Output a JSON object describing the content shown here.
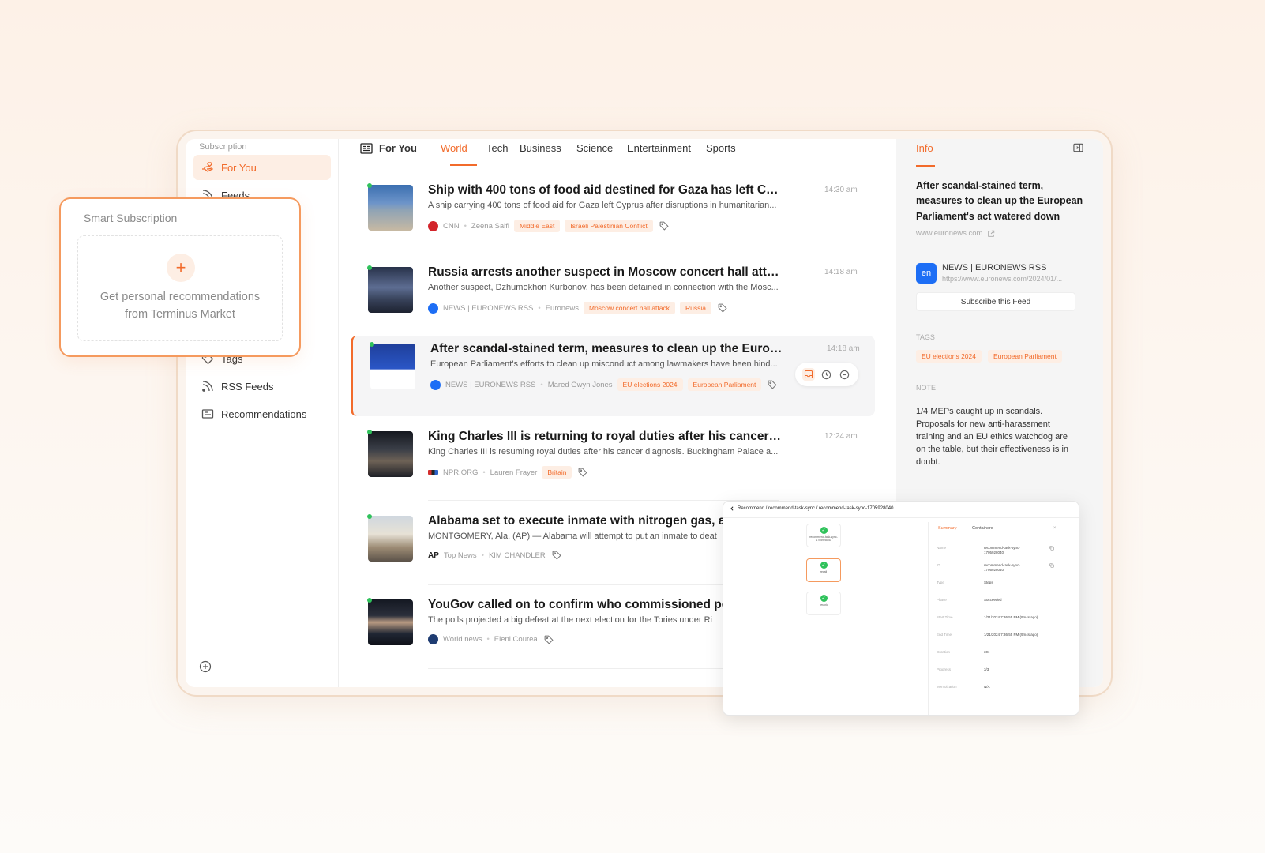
{
  "sidebar": {
    "header": "Subscription",
    "items": [
      {
        "label": "For You",
        "icon": "hand-heart-icon",
        "active": true
      },
      {
        "label": "Feeds",
        "icon": "rss-icon"
      },
      {
        "label": "Tags",
        "icon": "tag-icon"
      },
      {
        "label": "RSS Feeds",
        "icon": "rss-icon"
      },
      {
        "label": "Recommendations",
        "icon": "newspaper-icon"
      }
    ]
  },
  "tabs": {
    "for_you": "For You",
    "items": [
      "World",
      "Tech",
      "Business",
      "Science",
      "Entertainment",
      "Sports"
    ],
    "active": "World"
  },
  "articles": [
    {
      "title": "Ship with 400 tons of food aid destined for Gaza has left Cypr...",
      "summary": "A ship carrying 400 tons of food aid for Gaza left Cyprus after disruptions in humanitarian...",
      "time": "14:30 am",
      "source": "CNN",
      "author": "Zeena Saifi",
      "tags": [
        "Middle East",
        "Israeli Palestinian Conflict"
      ]
    },
    {
      "title": "Russia arrests another suspect in Moscow concert hall attack",
      "summary": "Another suspect, Dzhumokhon Kurbonov, has been detained in connection with the Mosc...",
      "time": "14:18 am",
      "source": "NEWS | EURONEWS RSS",
      "author": "Euronews",
      "tags": [
        "Moscow concert hall attack",
        "Russia"
      ]
    },
    {
      "title": "After scandal-stained term, measures to clean up the Europe...",
      "summary": "European Parliament's efforts to clean up misconduct among lawmakers have been hind...",
      "time": "14:18 am",
      "source": "NEWS | EURONEWS RSS",
      "author": "Mared Gwyn Jones",
      "tags": [
        "EU elections 2024",
        "European Parliament"
      ]
    },
    {
      "title": "King Charles III is returning to royal duties after his cancer di...",
      "summary": "King Charles III is resuming royal duties after his cancer diagnosis. Buckingham Palace a...",
      "time": "12:24 am",
      "source": "NPR.ORG",
      "author": "Lauren Frayer",
      "tags": [
        "Britain"
      ]
    },
    {
      "title": "Alabama set to execute inmate with nitrogen gas, a",
      "summary": "MONTGOMERY, Ala. (AP) — Alabama will attempt to put an inmate to deat",
      "time": "",
      "source": "Top News",
      "author": "KIM CHANDLER",
      "tags": []
    },
    {
      "title": "YouGov called on to confirm who commissioned po",
      "summary": "The polls projected a big defeat at the next election for the Tories under Ri",
      "time": "",
      "source": "World news",
      "author": "Eleni Courea",
      "tags": []
    }
  ],
  "info": {
    "tab": "Info",
    "title": "After scandal-stained term, measures to clean up the European Parliament's act watered down",
    "url": "www.euronews.com",
    "feed_logo": "en",
    "feed_name": "NEWS | EURONEWS RSS",
    "feed_url": "https://www.euronews.com/2024/01/...",
    "subscribe_label": "Subscribe this Feed",
    "tags_label": "TAGS",
    "tags": [
      "EU elections 2024",
      "European Parliament"
    ],
    "note_label": "NOTE",
    "note": "1/4 MEPs caught up in scandals. Proposals for new anti-harassment training and an EU ethics watchdog are on the table, but their effectiveness is in doubt."
  },
  "smart_subscription": {
    "title": "Smart Subscription",
    "plus": "+",
    "text_line1": "Get personal recommendations",
    "text_line2": "from Terminus Market"
  },
  "task": {
    "breadcrumb": "Recommend / recommend-task-sync / recommend-task-sync-1705928040",
    "nodes": [
      "recommend-task-sync-1705928040",
      "recall",
      "rerank"
    ],
    "tabs": [
      "Summary",
      "Containers"
    ],
    "rows": [
      {
        "k": "Name",
        "v": "recommend-task-sync-1705928040"
      },
      {
        "k": "ID",
        "v": "recommend-task-sync-1705928040"
      },
      {
        "k": "Type",
        "v": "Steps"
      },
      {
        "k": "Phase",
        "v": "Succeeded"
      },
      {
        "k": "Start Time",
        "v": "1/21/2024,7:36:55 PM (9m4s ago)"
      },
      {
        "k": "End Time",
        "v": "1/21/2024,7:36:55 PM (9m4s ago)"
      },
      {
        "k": "Duration",
        "v": "30s"
      },
      {
        "k": "Progress",
        "v": "3/3"
      },
      {
        "k": "Memoization",
        "v": "N/A"
      }
    ]
  },
  "colors": {
    "accent": "#f26b2b",
    "accent_bg": "#fdeee4",
    "unread": "#2fc25b"
  }
}
